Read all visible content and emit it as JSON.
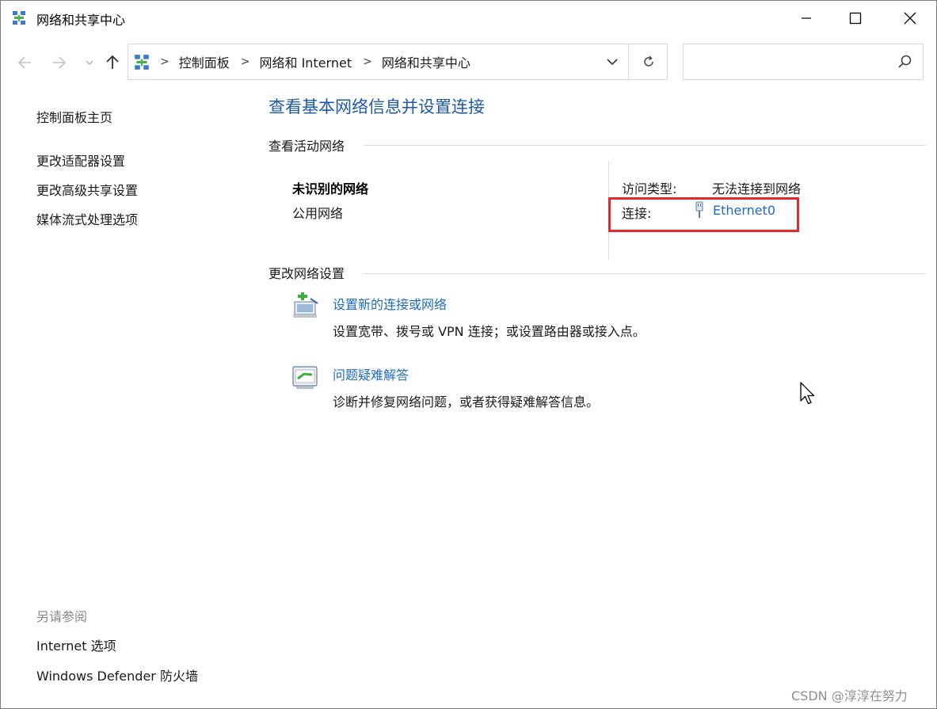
{
  "window": {
    "title": "网络和共享中心"
  },
  "address_bar": {
    "breadcrumbs": [
      "控制面板",
      "网络和 Internet",
      "网络和共享中心"
    ],
    "search_placeholder": ""
  },
  "sidebar": {
    "home_link": "控制面板主页",
    "links": [
      "更改适配器设置",
      "更改高级共享设置",
      "媒体流式处理选项"
    ],
    "see_also_label": "另请参阅",
    "see_also_links": [
      "Internet 选项",
      "Windows Defender 防火墙"
    ]
  },
  "main": {
    "heading": "查看基本网络信息并设置连接",
    "active_networks": {
      "section_title": "查看活动网络",
      "network_name": "未识别的网络",
      "network_category": "公用网络",
      "access_type_label": "访问类型:",
      "access_type_value": "无法连接到网络",
      "connections_label": "连接:",
      "connection_name": "Ethernet0"
    },
    "change_settings": {
      "section_title": "更改网络设置",
      "tasks": [
        {
          "link": "设置新的连接或网络",
          "description": "设置宽带、拨号或 VPN 连接；或设置路由器或接入点。",
          "icon": "new-connection-icon"
        },
        {
          "link": "问题疑难解答",
          "description": "诊断并修复网络问题，或者获得疑难解答信息。",
          "icon": "troubleshoot-icon"
        }
      ]
    }
  },
  "watermark": "CSDN @淳淳在努力",
  "colors": {
    "link_blue": "#1e6bc2",
    "heading_blue": "#1e5aa8",
    "highlight_red": "#e8272b"
  }
}
